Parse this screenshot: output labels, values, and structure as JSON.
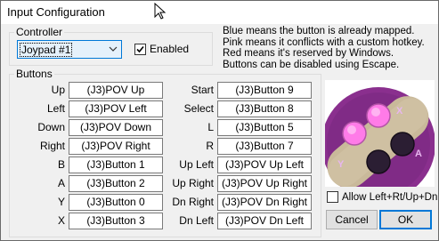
{
  "window": {
    "title": "Input Configuration"
  },
  "controller": {
    "legend": "Controller",
    "selected": "Joypad #1",
    "enabled_label": "Enabled",
    "enabled": true
  },
  "info_lines": [
    "Blue means the button is already mapped.",
    "Pink means it conflicts with a custom hotkey.",
    "Red means it's reserved by Windows.",
    "Buttons can be disabled using Escape."
  ],
  "buttons": {
    "legend": "Buttons",
    "left": [
      {
        "label": "Up",
        "value": "(J3)POV Up"
      },
      {
        "label": "Left",
        "value": "(J3)POV Left"
      },
      {
        "label": "Down",
        "value": "(J3)POV Down"
      },
      {
        "label": "Right",
        "value": "(J3)POV Right"
      },
      {
        "label": "B",
        "value": "(J3)Button 1"
      },
      {
        "label": "A",
        "value": "(J3)Button 2"
      },
      {
        "label": "Y",
        "value": "(J3)Button 0"
      },
      {
        "label": "X",
        "value": "(J3)Button 3"
      }
    ],
    "right": [
      {
        "label": "Start",
        "value": "(J3)Button 9"
      },
      {
        "label": "Select",
        "value": "(J3)Button 8"
      },
      {
        "label": "L",
        "value": "(J3)Button 5"
      },
      {
        "label": "R",
        "value": "(J3)Button 7"
      },
      {
        "label": "Up Left",
        "value": "(J3)POV Up Left"
      },
      {
        "label": "Up Right",
        "value": "(J3)POV Up Right"
      },
      {
        "label": "Dn Right",
        "value": "(J3)POV Dn Right"
      },
      {
        "label": "Dn Left",
        "value": "(J3)POV Dn Left"
      }
    ]
  },
  "preview": {
    "letters": {
      "x": "X",
      "a": "A",
      "y": "Y",
      "b": "B"
    },
    "colors": {
      "shell": "#8a2f8e",
      "base": "#c9b99a",
      "accent": "#ff7be8",
      "dark": "#2b1e33"
    }
  },
  "allow_diagonal": {
    "label": "Allow Left+Rt/Up+Dn",
    "checked": false
  },
  "actions": {
    "cancel": "Cancel",
    "ok": "OK"
  }
}
